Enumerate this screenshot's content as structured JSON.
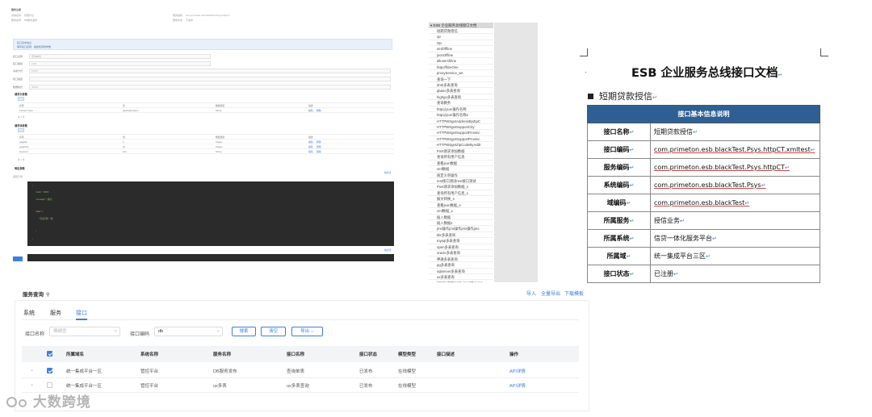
{
  "form_panel": {
    "breadcrumb": "服务注册",
    "meta_rows": [
      {
        "label": "系统名称",
        "value": "管理平台"
      },
      {
        "label": "服务名称",
        "value": "DB服务发布"
      }
    ],
    "meta_right": [
      {
        "label": "服务编码",
        "value": "com.primeton.esb.blackTest.Psys.httpCT"
      },
      {
        "label": "服务状态",
        "value": "已发布"
      }
    ],
    "info_box": {
      "title": "接口基本信息",
      "desc": "填写接口名称、描述和调用参数"
    },
    "fields": [
      {
        "label": "接口名称",
        "value": "查询单表"
      },
      {
        "label": "接口编码",
        "value": "cxdb"
      },
      {
        "label": "请求方式",
        "value": "POST"
      },
      {
        "label": "接口描述",
        "value": ""
      },
      {
        "label": "数据格式",
        "value": "JSON"
      }
    ],
    "sections": [
      {
        "title": "请求头参数"
      },
      {
        "title": "请求体参数"
      },
      {
        "title": "响应参数"
      }
    ],
    "table_headers": [
      "名称",
      "值",
      "数据类型",
      "描述",
      "操作"
    ],
    "header_rows": [
      {
        "name": "Content-Type",
        "value": "application/json",
        "type": "String",
        "op1": "编辑",
        "op2": "删除"
      }
    ],
    "body_rows": [
      {
        "name": "pageNo",
        "value": "1",
        "type": "Integer",
        "op1": "编辑",
        "op2": "删除"
      },
      {
        "name": "pageSize",
        "value": "10",
        "type": "Integer",
        "op1": "编辑",
        "op2": "删除"
      },
      {
        "name": "keyword",
        "value": "test",
        "type": "String",
        "op1": "编辑",
        "op2": "删除"
      }
    ],
    "pager": "共 1 条",
    "code_lines": [
      "{",
      "  \"code\": \"0000\",",
      "  \"message\": \"成功\",",
      "  \"data\": [",
      "    \"字段名称\": \"值\",",
      "  ]",
      "}"
    ],
    "response_label": "返回示例",
    "format_link": "格式化",
    "submit_label": "提交"
  },
  "outline": {
    "head": "ESB 企业服务总线接口文档",
    "items": [
      "短期贷款授信",
      "op",
      "Op",
      "xmlOffline",
      "jsonOffline",
      "allusersfrline",
      "httpofflineOne",
      "proxyService_ws",
      "查询一下",
      "dmb多表查询",
      "gbase多表查询",
      "highgo多表查询",
      "查询教务",
      "http以json操作名称",
      "http以json操作名称2",
      "HTTPWSgetAddressByZipC",
      "HTTPWSgetSupportCity",
      "HTTPWSgetSupportProvinc",
      "HTTPWSgetSupportProvinc",
      "HTTPWSgetZipCodeByAddr",
      "Post请求添加数据",
      "查询所有用户信息",
      "查看json数据",
      "xml数据",
      "商定义单操作",
      "rest接口测试rest接口测试",
      "Post请求添加数据_s",
      "查询所有用户信息_s",
      "报文转换_s",
      "查看json数据_s",
      "xml数据_s",
      "插入数据",
      "插入数据2",
      "jms操作jms操作jms操作jms",
      "kbr多表查询",
      "mysql多表查询",
      "open多表查询",
      "oracle多表查询",
      "神通多表查询",
      "pg多表查询",
      "sqlserver多表查询",
      "ux多表查询",
      "WSGHTTPgetSupportProvinc"
    ]
  },
  "doc": {
    "title": "ESB 企业服务总线接口文档",
    "subtitle": "短期贷款授信",
    "table_title": "接口基本信息说明",
    "rows": [
      {
        "key": "接口名称",
        "value": "短期贷款授信"
      },
      {
        "key": "接口编码",
        "value": "com.primeton.esb.blackTest.Psys.httpCT.xmltest"
      },
      {
        "key": "服务编码",
        "value": "com.primeton.esb.blackTest.Psys.httpCT"
      },
      {
        "key": "系统编码",
        "value": "com.primeton.esb.blackTest.Psys"
      },
      {
        "key": "域编码",
        "value": "com.primeton.esb.blackTest"
      },
      {
        "key": "所属服务",
        "value": "授信业务"
      },
      {
        "key": "所属系统",
        "value": "信贷一体化服务平台"
      },
      {
        "key": "所属域",
        "value": "统一集成平台三区"
      },
      {
        "key": "接口状态",
        "value": "已注册"
      }
    ],
    "para_mark": "↵"
  },
  "service_query": {
    "title": "服务查询",
    "top_links": [
      "导入",
      "全量导出",
      "下载模板"
    ],
    "tabs": [
      "系统",
      "服务",
      "接口"
    ],
    "active_tab": 2,
    "filters": {
      "name_label": "接口名称",
      "name_placeholder": "模糊查",
      "code_label": "接口编码",
      "code_value": "db"
    },
    "buttons": {
      "search": "搜索",
      "clear": "清空",
      "export": "导出 ⌵"
    },
    "columns": [
      "所属域名",
      "系统名称",
      "服务名称",
      "接口名称",
      "接口状态",
      "模型类型",
      "接口描述",
      "操作"
    ],
    "rows": [
      {
        "checked": true,
        "domain": "统一集成平台一区",
        "system": "管控平台",
        "service": "DB服务发布",
        "api": "查询单表",
        "status": "已发布",
        "model": "在线模型",
        "desc": "",
        "action": "API详情"
      },
      {
        "checked": false,
        "domain": "统一集成平台一区",
        "system": "管控平台",
        "service": "ux多表",
        "api": "ux多表查询",
        "status": "已发布",
        "model": "在线模型",
        "desc": "",
        "action": "API详情"
      }
    ]
  },
  "watermark": "大数跨境",
  "colors": {
    "accent": "#3d7fe0",
    "doc_header": "#2e5f94",
    "code_bg": "#2b2b2b"
  }
}
